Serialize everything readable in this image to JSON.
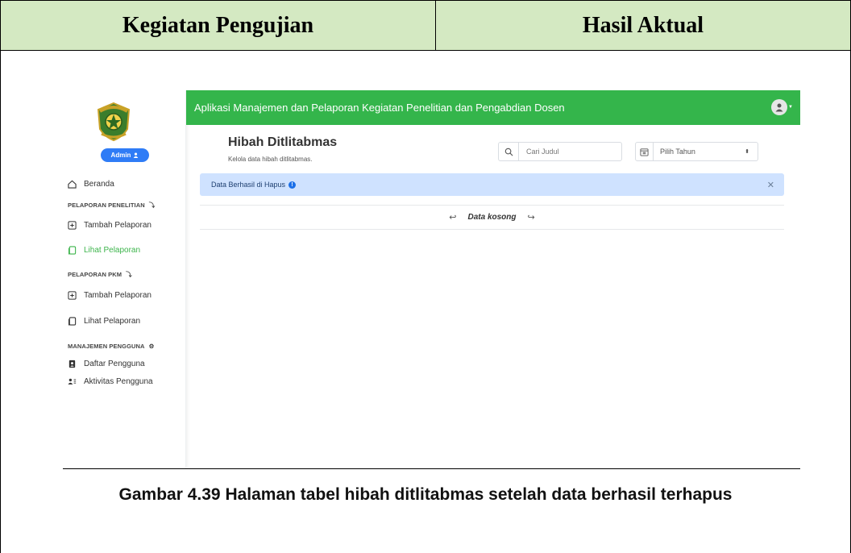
{
  "doc": {
    "col_left": "Kegiatan Pengujian",
    "col_right": "Hasil Aktual",
    "caption": "Gambar 4.39 Halaman tabel hibah ditlitabmas setelah data berhasil terhapus"
  },
  "app": {
    "header_title": "Aplikasi Manajemen dan Pelaporan Kegiatan Penelitian dan Pengabdian Dosen",
    "admin_label": "Admin",
    "sidebar": {
      "beranda": "Beranda",
      "section_penelitian": "PELAPORAN PENELITIAN",
      "penelitian_tambah": "Tambah Pelaporan",
      "penelitian_lihat": "Lihat Pelaporan",
      "section_pkm": "PELAPORAN PKM",
      "pkm_tambah": "Tambah Pelaporan",
      "pkm_lihat": "Lihat Pelaporan",
      "section_manajemen": "MANAJEMEN PENGGUNA",
      "daftar_pengguna": "Daftar Pengguna",
      "aktivitas_pengguna": "Aktivitas Pengguna"
    },
    "page_title": "Hibah Ditlitabmas",
    "page_subtitle": "Kelola data hibah ditlitabmas.",
    "search_placeholder": "Cari Judul",
    "year_placeholder": "Pilih Tahun",
    "alert_text": "Data Berhasil di Hapus",
    "empty_text": "Data kosong",
    "colors": {
      "green": "#34b54b",
      "blue": "#2f7cf6",
      "alert_bg": "#cfe2ff",
      "header_bg": "#d4e9c2"
    },
    "icons": [
      "home-icon",
      "plus-square-icon",
      "copy-icon",
      "user-badge-icon",
      "users-icon",
      "search-icon",
      "calendar-icon",
      "info-icon",
      "close-icon",
      "user-avatar-icon"
    ]
  }
}
